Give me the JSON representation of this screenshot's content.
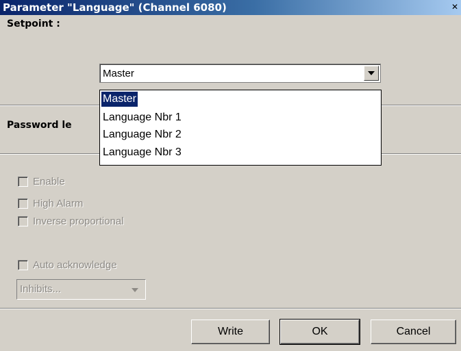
{
  "window": {
    "title": "Parameter \"Language\" (Channel 6080)",
    "close_glyph": "✕"
  },
  "setpoint": {
    "label": "Setpoint :",
    "selected": "Master",
    "options": [
      "Master",
      "Language Nbr 1",
      "Language Nbr 2",
      "Language Nbr 3"
    ]
  },
  "password": {
    "label": "Password le"
  },
  "alarm": {
    "enable_label": "Enable",
    "high_alarm_label": "High Alarm",
    "inverse_label": "Inverse proportional",
    "auto_ack_label": "Auto acknowledge",
    "enable_checked": false,
    "high_alarm_checked": false,
    "inverse_checked": false,
    "auto_ack_checked": false,
    "inhibits_value": "Inhibits..."
  },
  "buttons": {
    "write": "Write",
    "ok": "OK",
    "cancel": "Cancel"
  },
  "colors": {
    "titlebar_start": "#0a246a",
    "titlebar_end": "#a6caf0",
    "face": "#d4d0c8",
    "selection": "#0a246a",
    "disabled_text": "#8d8a85"
  }
}
